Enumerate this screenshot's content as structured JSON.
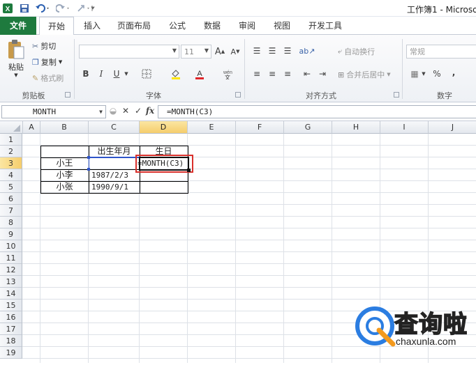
{
  "titlebar": {
    "title": "工作簿1 - Microso",
    "icons": [
      "excel-logo",
      "save-icon",
      "undo-icon",
      "redo-icon",
      "customize-icon"
    ]
  },
  "tabs": [
    {
      "label": "文件"
    },
    {
      "label": "开始"
    },
    {
      "label": "插入"
    },
    {
      "label": "页面布局"
    },
    {
      "label": "公式"
    },
    {
      "label": "数据"
    },
    {
      "label": "审阅"
    },
    {
      "label": "视图"
    },
    {
      "label": "开发工具"
    }
  ],
  "ribbon": {
    "clipboard": {
      "paste": "粘贴",
      "cut": "剪切",
      "copy": "复制",
      "format_painter": "格式刷",
      "label": "剪贴板"
    },
    "font": {
      "font_size": "11",
      "label": "字体",
      "bold": "B",
      "italic": "I",
      "underline": "U"
    },
    "alignment": {
      "wrap_text": "自动换行",
      "merge_center": "合并后居中",
      "label": "对齐方式"
    },
    "number": {
      "format": "常规",
      "percent": "%",
      "comma": ",",
      "label": "数字"
    }
  },
  "formula_bar": {
    "name_box": "MONTH",
    "fx": "fx",
    "cancel": "✕",
    "enter": "✓",
    "formula": "=MONTH(C3)"
  },
  "sheet": {
    "columns": [
      "A",
      "B",
      "C",
      "D",
      "E",
      "F",
      "G",
      "H",
      "I",
      "J"
    ],
    "rows": [
      "1",
      "2",
      "3",
      "4",
      "5",
      "6",
      "7",
      "8",
      "9",
      "10",
      "11",
      "12",
      "13",
      "14",
      "15",
      "16",
      "17",
      "18",
      "19"
    ],
    "selected_column": "D",
    "selected_row": "3",
    "cells": {
      "C2": "出生年月",
      "D2": "生日",
      "B3": "小王",
      "D3": "=MONTH(C3)",
      "B4": "小李",
      "C4": "1987/2/3",
      "B5": "小张",
      "C5": "1990/9/1"
    }
  },
  "watermark": {
    "brand": "查询啦",
    "domain": "chaxunla.com"
  },
  "colors": {
    "file_tab": "#1e7a3e",
    "selection_header": "#f5cd6c",
    "highlight_box": "#d9302b",
    "watermark_blue": "#2b7de1"
  }
}
